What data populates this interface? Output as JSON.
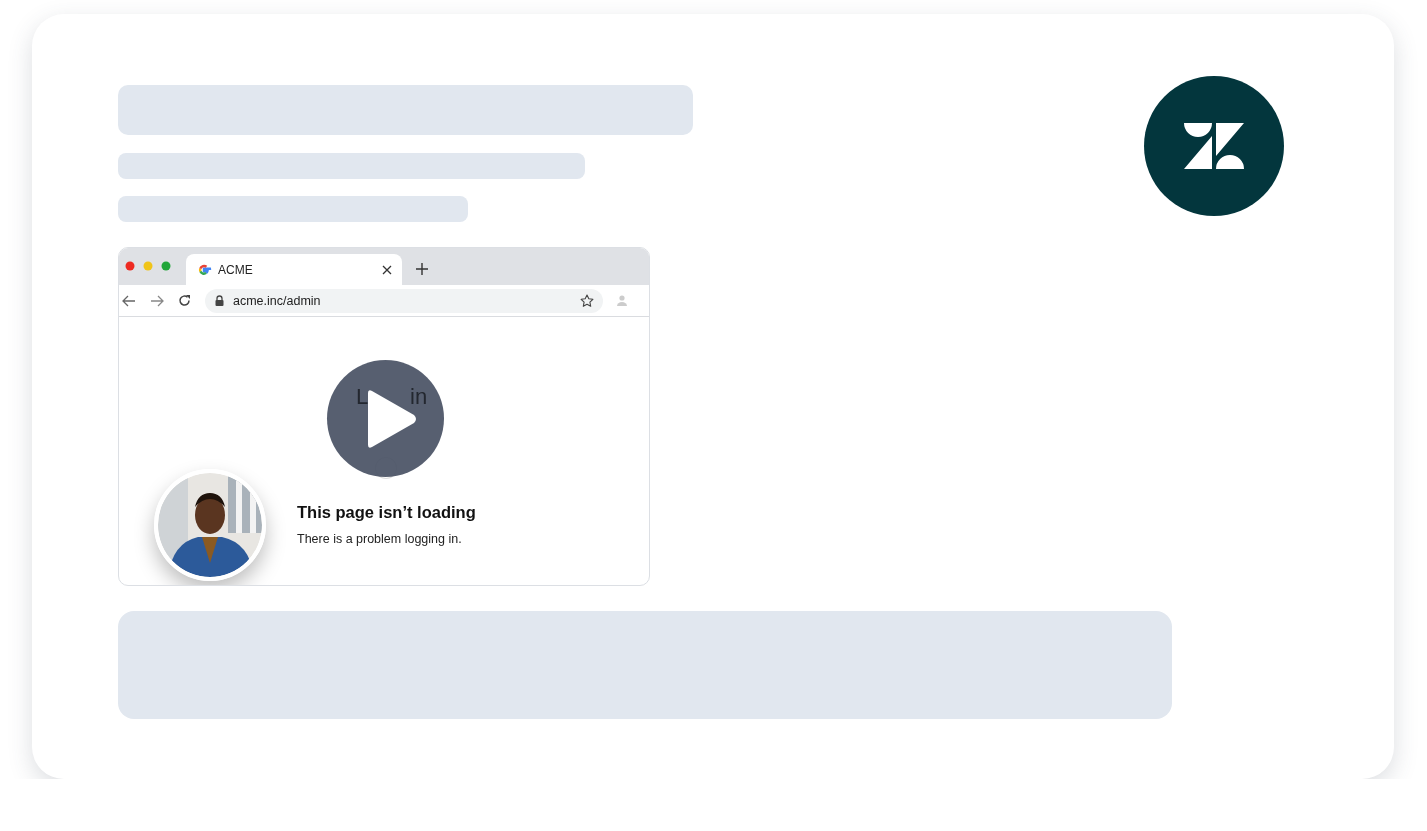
{
  "browser": {
    "tab": {
      "title": "ACME"
    },
    "address": "acme.inc/admin",
    "page": {
      "heading_parts": [
        "L",
        "in"
      ],
      "error_title": "This page isn’t loading",
      "error_message": "There is a problem logging in."
    }
  }
}
